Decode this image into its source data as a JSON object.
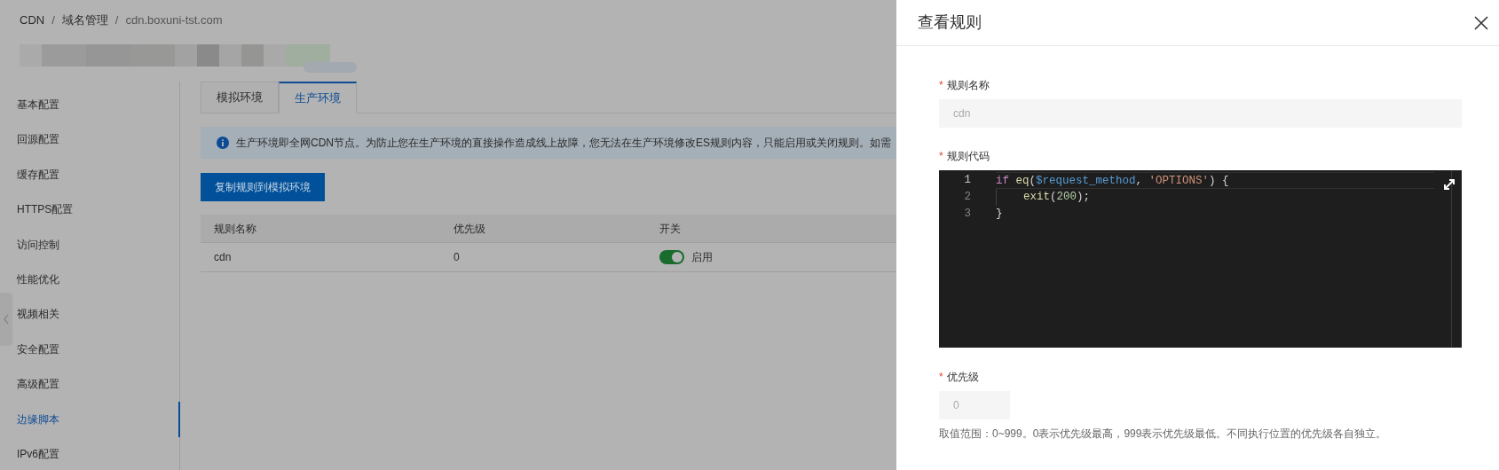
{
  "breadcrumb": {
    "separator": "/",
    "items": [
      "CDN",
      "域名管理",
      "cdn.boxuni-tst.com"
    ]
  },
  "sidebar": {
    "items": [
      {
        "label": "基本配置",
        "selected": false
      },
      {
        "label": "回源配置",
        "selected": false
      },
      {
        "label": "缓存配置",
        "selected": false
      },
      {
        "label": "HTTPS配置",
        "selected": false
      },
      {
        "label": "访问控制",
        "selected": false
      },
      {
        "label": "性能优化",
        "selected": false
      },
      {
        "label": "视频相关",
        "selected": false
      },
      {
        "label": "安全配置",
        "selected": false
      },
      {
        "label": "高级配置",
        "selected": false
      },
      {
        "label": "边缘脚本",
        "selected": true
      },
      {
        "label": "IPv6配置",
        "selected": false
      }
    ]
  },
  "tabs": [
    {
      "label": "模拟环境",
      "selected": false
    },
    {
      "label": "生产环境",
      "selected": true
    }
  ],
  "alert": {
    "text": "生产环境即全网CDN节点。为防止您在生产环境的直接操作造成线上故障，您无法在生产环境修改ES规则内容，只能启用或关闭规则。如需"
  },
  "copy_button": {
    "label": "复制规则到模拟环境"
  },
  "table": {
    "columns": [
      "规则名称",
      "优先级",
      "开关"
    ],
    "rows": [
      {
        "name": "cdn",
        "priority": "0",
        "enabled": true,
        "switch_label": "启用"
      }
    ]
  },
  "drawer": {
    "title": "查看规则",
    "name_field": {
      "label": "规则名称",
      "marker": "*",
      "value": "cdn",
      "disabled": true
    },
    "code_field": {
      "label": "规则代码",
      "marker": "*",
      "lines": [
        {
          "number": "1",
          "active": true,
          "indent": false,
          "tokens": [
            {
              "kind": "keyword",
              "text": "if"
            },
            {
              "kind": "function",
              "text": " eq"
            },
            {
              "kind": "plain",
              "text": "("
            },
            {
              "kind": "variable",
              "text": "$request_method"
            },
            {
              "kind": "plain",
              "text": ", "
            },
            {
              "kind": "string",
              "text": "'OPTIONS'"
            },
            {
              "kind": "plain",
              "text": ") {"
            }
          ]
        },
        {
          "number": "2",
          "active": false,
          "indent": true,
          "tokens": [
            {
              "kind": "function",
              "text": "exit"
            },
            {
              "kind": "plain",
              "text": "("
            },
            {
              "kind": "number",
              "text": "200"
            },
            {
              "kind": "plain",
              "text": ");"
            }
          ]
        },
        {
          "number": "3",
          "active": false,
          "indent": false,
          "tokens": [
            {
              "kind": "plain",
              "text": "}"
            }
          ]
        }
      ]
    },
    "priority_field": {
      "label": "优先级",
      "marker": "*",
      "value": "0",
      "disabled": true,
      "help": "取值范围：0~999。0表示优先级最高，999表示优先级最低。不同执行位置的优先级各自独立。"
    }
  }
}
